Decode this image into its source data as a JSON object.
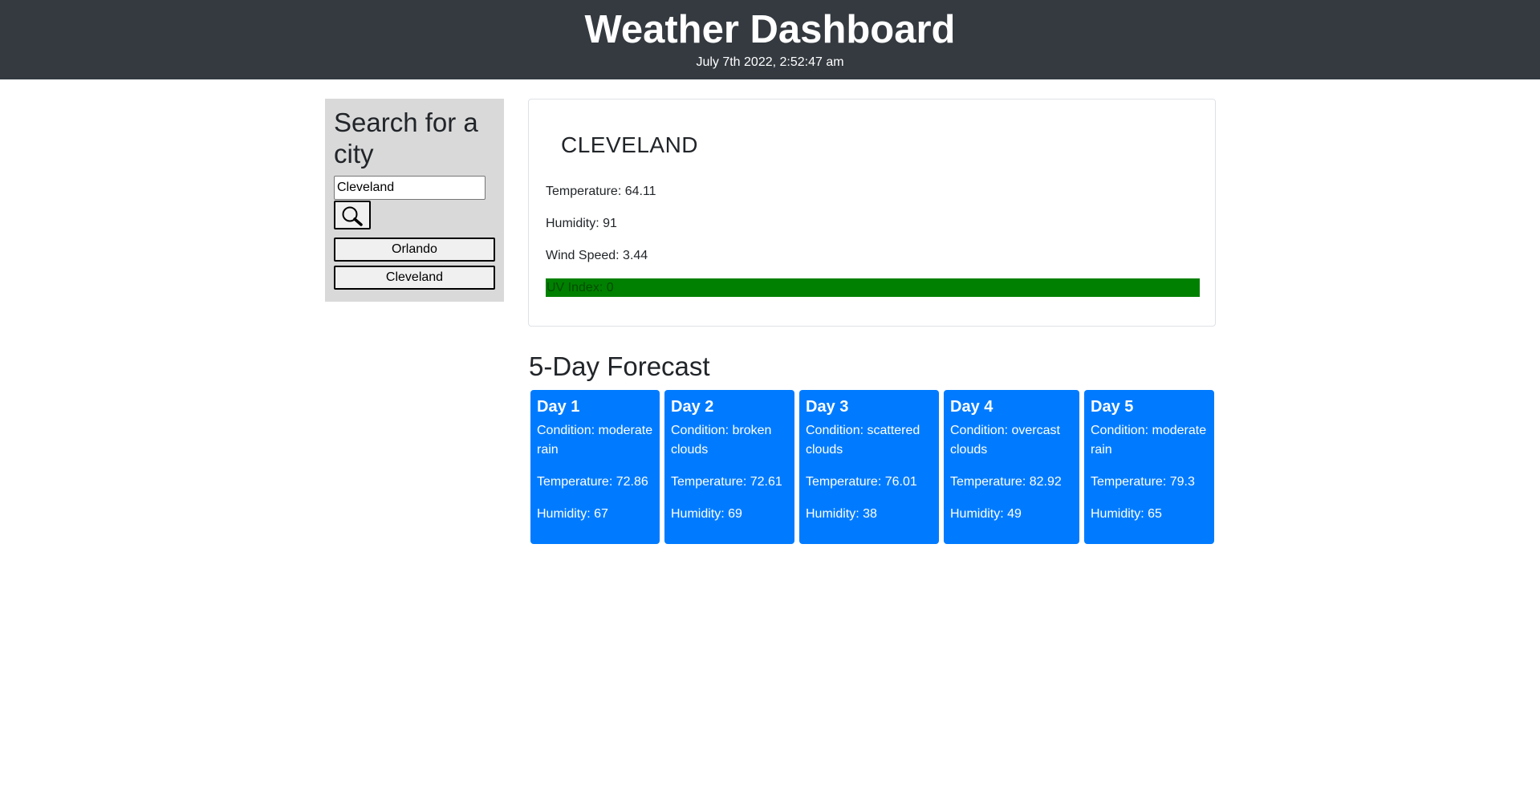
{
  "header": {
    "title": "Weather Dashboard",
    "date": "July 7th 2022, 2:52:47 am"
  },
  "search": {
    "heading": "Search for a city",
    "input_value": "Cleveland",
    "button_icon": "search-icon",
    "history": [
      "Orlando",
      "Cleveland"
    ]
  },
  "current": {
    "city": "CLEVELAND",
    "temperature": "Temperature: 64.11",
    "humidity": "Humidity: 91",
    "wind": "Wind Speed: 3.44",
    "uv": "UV Index: 0",
    "uv_color": "#008000"
  },
  "forecast": {
    "title": "5-Day Forecast",
    "card_color": "#007bff",
    "days": [
      {
        "day": "Day 1",
        "condition": "Condition: moderate rain",
        "temperature": "Temperature: 72.86",
        "humidity": "Humidity: 67"
      },
      {
        "day": "Day 2",
        "condition": "Condition: broken clouds",
        "temperature": "Temperature: 72.61",
        "humidity": "Humidity: 69"
      },
      {
        "day": "Day 3",
        "condition": "Condition: scattered clouds",
        "temperature": "Temperature: 76.01",
        "humidity": "Humidity: 38"
      },
      {
        "day": "Day 4",
        "condition": "Condition: overcast clouds",
        "temperature": "Temperature: 82.92",
        "humidity": "Humidity: 49"
      },
      {
        "day": "Day 5",
        "condition": "Condition: moderate rain",
        "temperature": "Temperature: 79.3",
        "humidity": "Humidity: 65"
      }
    ]
  }
}
